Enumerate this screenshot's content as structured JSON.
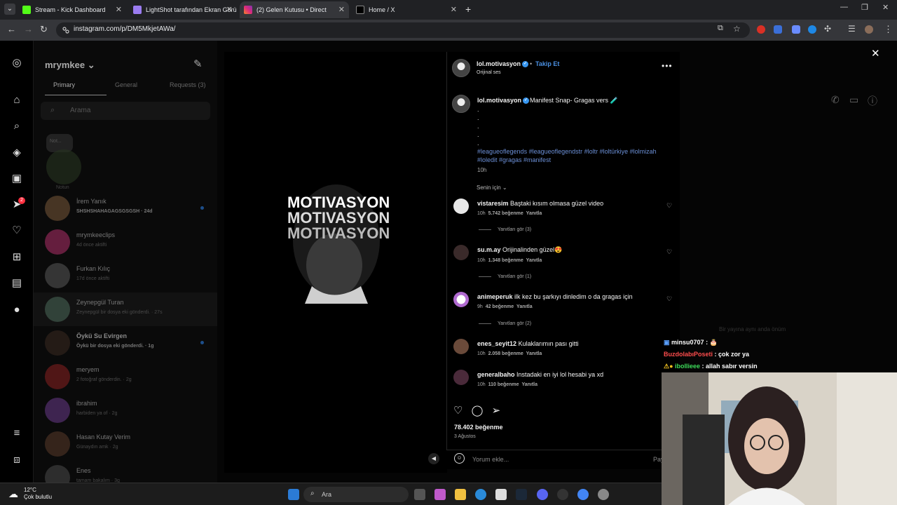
{
  "browser": {
    "tabs": [
      {
        "title": "Stream - Kick Dashboard",
        "color": "#53fc18"
      },
      {
        "title": "LightShot tarafından Ekran Görü",
        "color": "#9b7cf0"
      },
      {
        "title": "(2) Gelen Kutusu • Direct",
        "color": "#e1306c"
      },
      {
        "title": "Home / X",
        "color": "#000000"
      }
    ],
    "url": "instagram.com/p/DM5MkjetAWa/"
  },
  "dm": {
    "username": "mrymkee",
    "tabs": [
      "Primary",
      "General",
      "Requests (3)"
    ],
    "search_placeholder": "Arama",
    "note_bubble": "Not...",
    "note_label": "Notun",
    "notification_badge": "2",
    "conversations": [
      {
        "name": "İrem Yanık",
        "sub": "SHSHSHAHAGAGSGSGSH · 24d",
        "bold": true,
        "unread": true
      },
      {
        "name": "mrymkeeclips",
        "sub": "4d önce aktifti",
        "bold": false,
        "unread": false
      },
      {
        "name": "Furkan Kılıç",
        "sub": "17d önce aktifti",
        "bold": false,
        "unread": false
      },
      {
        "name": "Zeynepgül Turan",
        "sub": "Zeynepgül bir dosya eki gönderdi. · 27s",
        "bold": false,
        "unread": false,
        "selected": true
      },
      {
        "name": "Öykü Su Evirgen",
        "sub": "Öykü bir dosya eki gönderdi. · 1g",
        "bold": true,
        "unread": true
      },
      {
        "name": "meryem",
        "sub": "2 fotoğraf gönderdin. · 2g",
        "bold": false,
        "unread": false
      },
      {
        "name": "ibrahim",
        "sub": "harbiden ya of · 2g",
        "bold": false,
        "unread": false
      },
      {
        "name": "Hasan Kutay Verim",
        "sub": "Günaydın amk · 2g",
        "bold": false,
        "unread": false
      },
      {
        "name": "Enes",
        "sub": "tamam bakalım · 3g",
        "bold": false,
        "unread": false
      }
    ]
  },
  "post": {
    "author": "lol.motivasyon",
    "follow_label": "Takip Et",
    "audio": "Orijinal ses",
    "caption": "Manifest Snap- Gragas vers 🧪",
    "caption_dots": ".\n.\n.\n.\n.",
    "hashtags": "#leagueoflegends #leagueoflegendstr #loltr #loltürkiye #lolmizah #loledit #gragas #manifest",
    "caption_time": "10h",
    "sort_label": "Senin için",
    "art_text": "MOTIVASYON",
    "comments": [
      {
        "user": "vistaresim",
        "text": "Baştaki kısım olmasa güzel video",
        "time": "10h",
        "likes": "5.742 beğenme",
        "reply": "Yanıtla",
        "view_replies": "Yanıtları gör (3)"
      },
      {
        "user": "su.m.ay",
        "text": "Orijinalinden güzel😍",
        "time": "10h",
        "likes": "1.348 beğenme",
        "reply": "Yanıtla",
        "view_replies": "Yanıtları gör (1)"
      },
      {
        "user": "animeperuk",
        "text": "ilk kez bu şarkıyı dinledim o da gragas için",
        "time": "9h",
        "likes": "42 beğenme",
        "reply": "Yanıtla",
        "view_replies": "Yanıtları gör (2)"
      },
      {
        "user": "enes_seyit12",
        "text": "Kulaklarımın pası gitti",
        "time": "10h",
        "likes": "2.058 beğenme",
        "reply": "Yanıtla",
        "view_replies": ""
      },
      {
        "user": "generalbaho",
        "text": "Instadaki en iyi lol hesabi ya xd",
        "time": "10h",
        "likes": "110 beğenme",
        "reply": "Yanıtla",
        "view_replies": ""
      }
    ],
    "total_likes": "78.402 beğenme",
    "date": "3 Ağustos",
    "comment_placeholder": "Yorum ekle...",
    "post_label": "Paylaş"
  },
  "stream_chat": {
    "ghost": "Bir yayına aynı anda önüm",
    "messages": [
      {
        "user": "minsu0707",
        "text": " : 🎂",
        "color": "#ffffff"
      },
      {
        "user": "BuzdolabıPoseti",
        "text": " : çok zor ya",
        "color": "#ff4d4d"
      },
      {
        "user": "ibollieee",
        "text": " : allah sabır versin",
        "color": "#3ddc5a"
      }
    ]
  },
  "taskbar": {
    "temp": "12°C",
    "weather": "Çok bulutlu",
    "search": "Ara"
  }
}
